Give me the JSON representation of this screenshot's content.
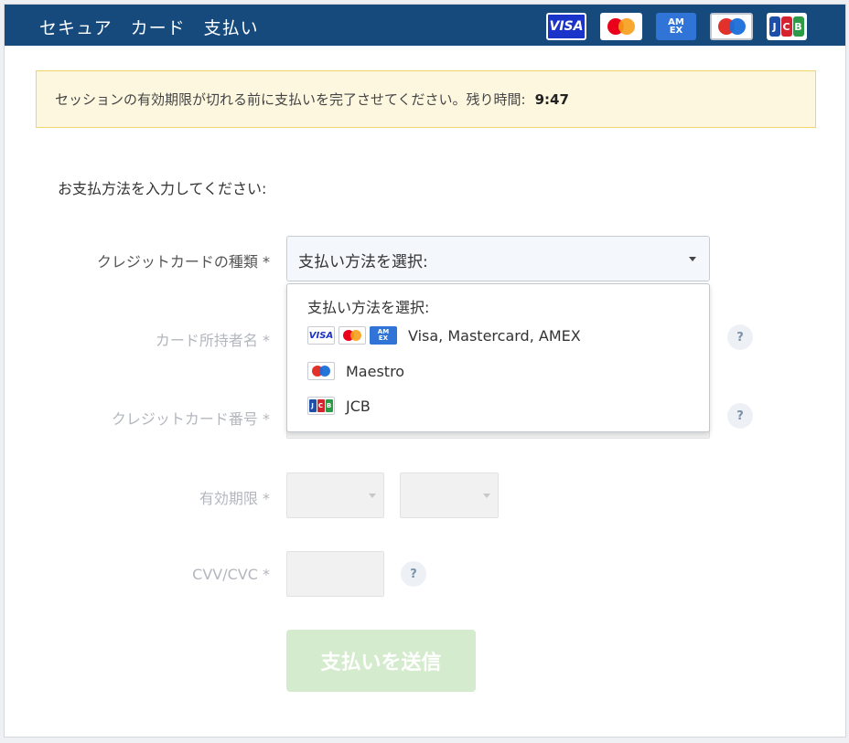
{
  "header": {
    "title": "セキュア　カード　支払い",
    "brands": [
      {
        "name": "visa",
        "text": "VISA"
      },
      {
        "name": "mastercard"
      },
      {
        "name": "amex",
        "text": "AM EX"
      },
      {
        "name": "maestro"
      },
      {
        "name": "jcb",
        "text": "JCB"
      }
    ]
  },
  "notice": {
    "text": "セッションの有効期限が切れる前に支払いを完了させてください。残り時間:",
    "time": "9:47"
  },
  "form": {
    "prompt": "お支払方法を入力してください:",
    "card_type_label": "クレジットカードの種類 *",
    "card_type_value": "支払い方法を選択:",
    "holder_label": "カード所持者名 *",
    "number_label": "クレジットカード番号 *",
    "expiry_label": "有効期限 *",
    "cvv_label": "CVV/CVC *",
    "help_glyph": "?",
    "submit_label": "支払いを送信"
  },
  "dropdown": {
    "header": "支払い方法を選択:",
    "options": [
      {
        "label": "Visa, Mastercard, AMEX"
      },
      {
        "label": "Maestro"
      },
      {
        "label": "JCB"
      }
    ]
  },
  "colors": {
    "header_bg": "#174a7c",
    "notice_bg": "#fdf7e0",
    "submit_disabled": "#d5ebcd"
  }
}
